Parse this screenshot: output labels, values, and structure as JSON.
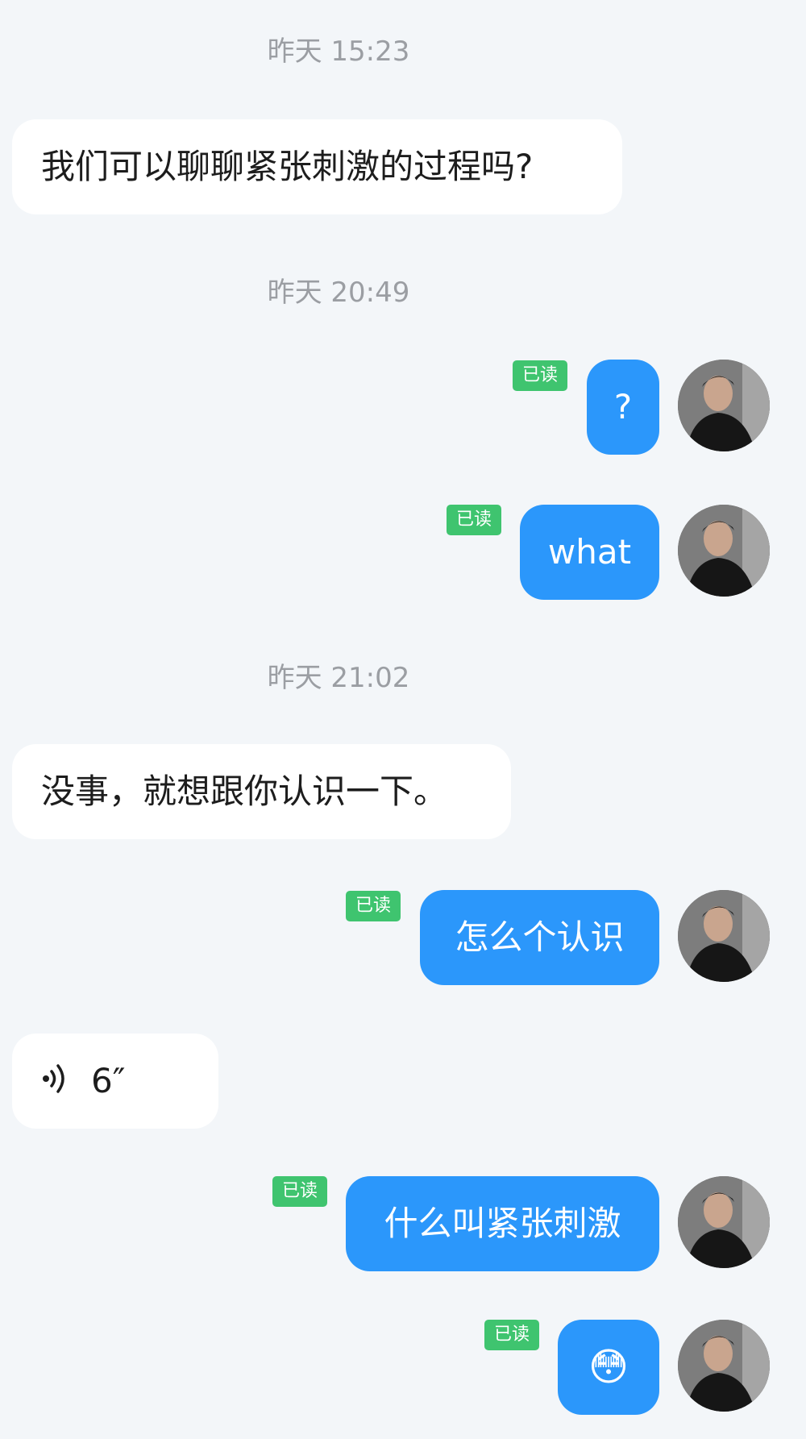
{
  "timestamps": [
    "昨天 15:23",
    "昨天 20:49",
    "昨天 21:02"
  ],
  "read_label": "已读",
  "messages": [
    {
      "side": "in",
      "text": "我们可以聊聊紧张刺激的过程吗?"
    },
    {
      "side": "out",
      "text": "?",
      "read": true
    },
    {
      "side": "out",
      "text": "what",
      "read": true
    },
    {
      "side": "in",
      "text": "没事，就想跟你认识一下。"
    },
    {
      "side": "out",
      "text": "怎么个认识",
      "read": true
    },
    {
      "side": "in",
      "type": "voice",
      "text": "6″",
      "icon": "voice-wave-icon"
    },
    {
      "side": "out",
      "text": "什么叫紧张刺激",
      "read": true
    },
    {
      "side": "out",
      "type": "emoji",
      "text": "😳",
      "read": true
    }
  ],
  "colors": {
    "background": "#f3f6f9",
    "incoming_bubble": "#ffffff",
    "outgoing_bubble": "#2b97fb",
    "read_badge": "#3fc46f",
    "timestamp_text": "#9b9ea3"
  }
}
